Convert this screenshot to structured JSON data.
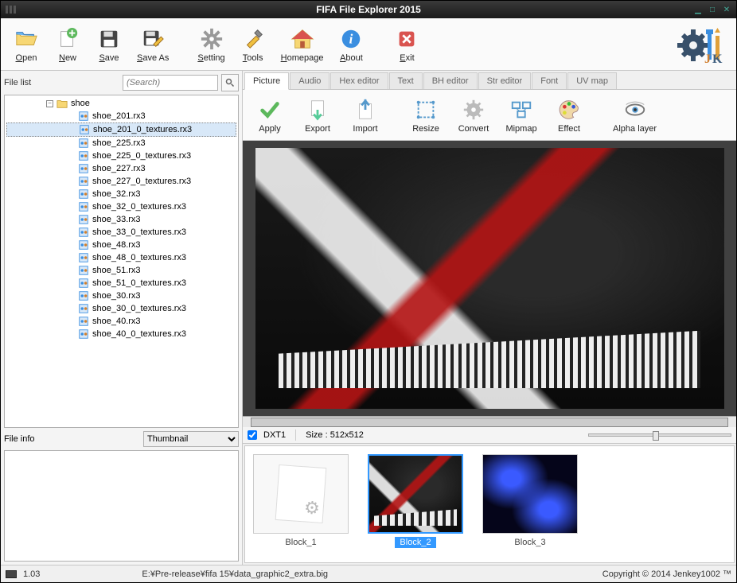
{
  "window": {
    "title": "FIFA File Explorer 2015"
  },
  "main_toolbar": [
    {
      "key": "open",
      "label": "Open",
      "icon": "folder-open-icon"
    },
    {
      "key": "new",
      "label": "New",
      "icon": "new-icon"
    },
    {
      "key": "save",
      "label": "Save",
      "icon": "floppy-icon"
    },
    {
      "key": "saveas",
      "label": "Save As",
      "icon": "floppy-pencil-icon"
    },
    {
      "key": "setting",
      "label": "Setting",
      "icon": "gear-icon"
    },
    {
      "key": "tools",
      "label": "Tools",
      "icon": "tools-icon"
    },
    {
      "key": "homepage",
      "label": "Homepage",
      "icon": "home-icon"
    },
    {
      "key": "about",
      "label": "About",
      "icon": "info-icon"
    },
    {
      "key": "exit",
      "label": "Exit",
      "icon": "exit-icon"
    }
  ],
  "left": {
    "file_list_label": "File list",
    "search_placeholder": "(Search)",
    "root_label": "shoe",
    "files": [
      "shoe_201.rx3",
      "shoe_201_0_textures.rx3",
      "shoe_225.rx3",
      "shoe_225_0_textures.rx3",
      "shoe_227.rx3",
      "shoe_227_0_textures.rx3",
      "shoe_32.rx3",
      "shoe_32_0_textures.rx3",
      "shoe_33.rx3",
      "shoe_33_0_textures.rx3",
      "shoe_48.rx3",
      "shoe_48_0_textures.rx3",
      "shoe_51.rx3",
      "shoe_51_0_textures.rx3",
      "shoe_30.rx3",
      "shoe_30_0_textures.rx3",
      "shoe_40.rx3",
      "shoe_40_0_textures.rx3"
    ],
    "selected_index": 1,
    "file_info_label": "File info",
    "thumbnail_dropdown": "Thumbnail"
  },
  "tabs": [
    "Picture",
    "Audio",
    "Hex editor",
    "Text",
    "BH editor",
    "Str editor",
    "Font",
    "UV map"
  ],
  "active_tab": 0,
  "picture_toolbar": [
    {
      "key": "apply",
      "label": "Apply",
      "icon": "check-icon"
    },
    {
      "key": "export",
      "label": "Export",
      "icon": "export-icon"
    },
    {
      "key": "import",
      "label": "Import",
      "icon": "import-icon"
    },
    {
      "key": "resize",
      "label": "Resize",
      "icon": "resize-icon"
    },
    {
      "key": "convert",
      "label": "Convert",
      "icon": "convert-icon"
    },
    {
      "key": "mipmap",
      "label": "Mipmap",
      "icon": "mipmap-icon"
    },
    {
      "key": "effect",
      "label": "Effect",
      "icon": "palette-icon"
    },
    {
      "key": "alpha",
      "label": "Alpha layer",
      "icon": "eye-icon"
    }
  ],
  "texture_info": {
    "format": "DXT1",
    "size_label": "Size : 512x512"
  },
  "blocks": [
    {
      "label": "Block_1",
      "kind": "generic"
    },
    {
      "label": "Block_2",
      "kind": "shoe"
    },
    {
      "label": "Block_3",
      "kind": "blue"
    }
  ],
  "selected_block": 1,
  "status": {
    "version": "1.03",
    "path": "E:¥Pre-release¥fifa 15¥data_graphic2_extra.big",
    "copyright": "Copyright © 2014 Jenkey1002 ™"
  }
}
